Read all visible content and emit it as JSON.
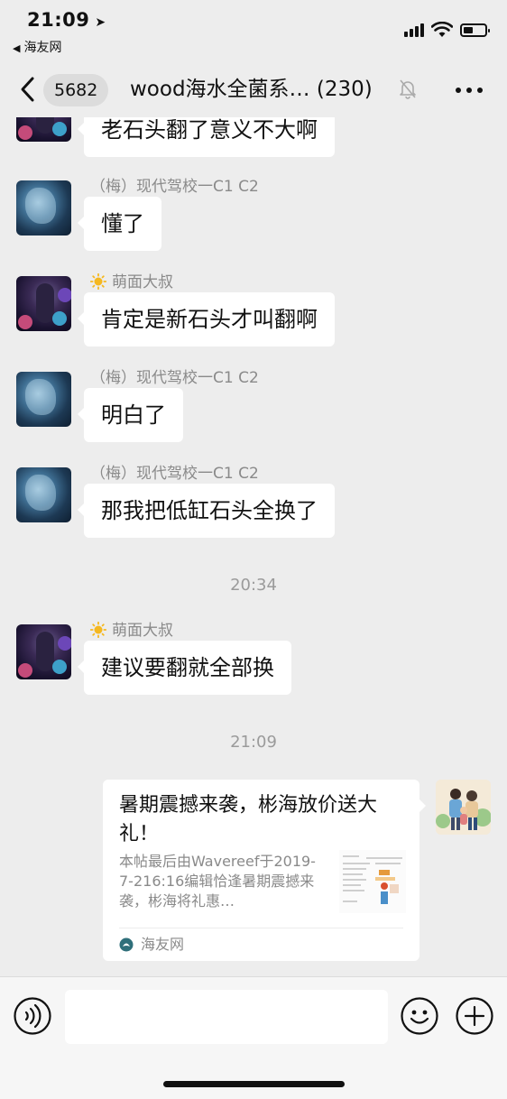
{
  "status_bar": {
    "time": "21:09",
    "back_app_label": "海友网",
    "battery_level": 0.45
  },
  "nav": {
    "unread_count": "5682",
    "title": "wood海水全菌系… (230)",
    "muted": true
  },
  "messages": [
    {
      "sender": "",
      "text": "老石头翻了意义不大啊",
      "avatar": "dark"
    },
    {
      "sender": "（梅）现代驾校一C1 C2",
      "text": "懂了",
      "avatar": "blue"
    },
    {
      "sender": "萌面大叔",
      "sender_icon": "sun-icon",
      "text": "肯定是新石头才叫翻啊",
      "avatar": "dark"
    },
    {
      "sender": "（梅）现代驾校一C1 C2",
      "text": "明白了",
      "avatar": "blue"
    },
    {
      "sender": "（梅）现代驾校一C1 C2",
      "text": "那我把低缸石头全换了",
      "avatar": "blue"
    },
    {
      "timestamp": "20:34"
    },
    {
      "sender": "萌面大叔",
      "sender_icon": "sun-icon",
      "text": "建议要翻就全部换",
      "avatar": "dark"
    },
    {
      "timestamp": "21:09"
    }
  ],
  "link_card": {
    "title": "暑期震撼来袭，彬海放价送大礼！",
    "description": "本帖最后由Wavereef于2019-7-216:16编辑恰逢暑期震撼来袭，彬海将礼惠…",
    "source": "海友网"
  },
  "input_bar": {
    "placeholder": ""
  },
  "colors": {
    "background": "#ededed",
    "bubble": "#ffffff",
    "meta_text": "#8a8a8a"
  }
}
